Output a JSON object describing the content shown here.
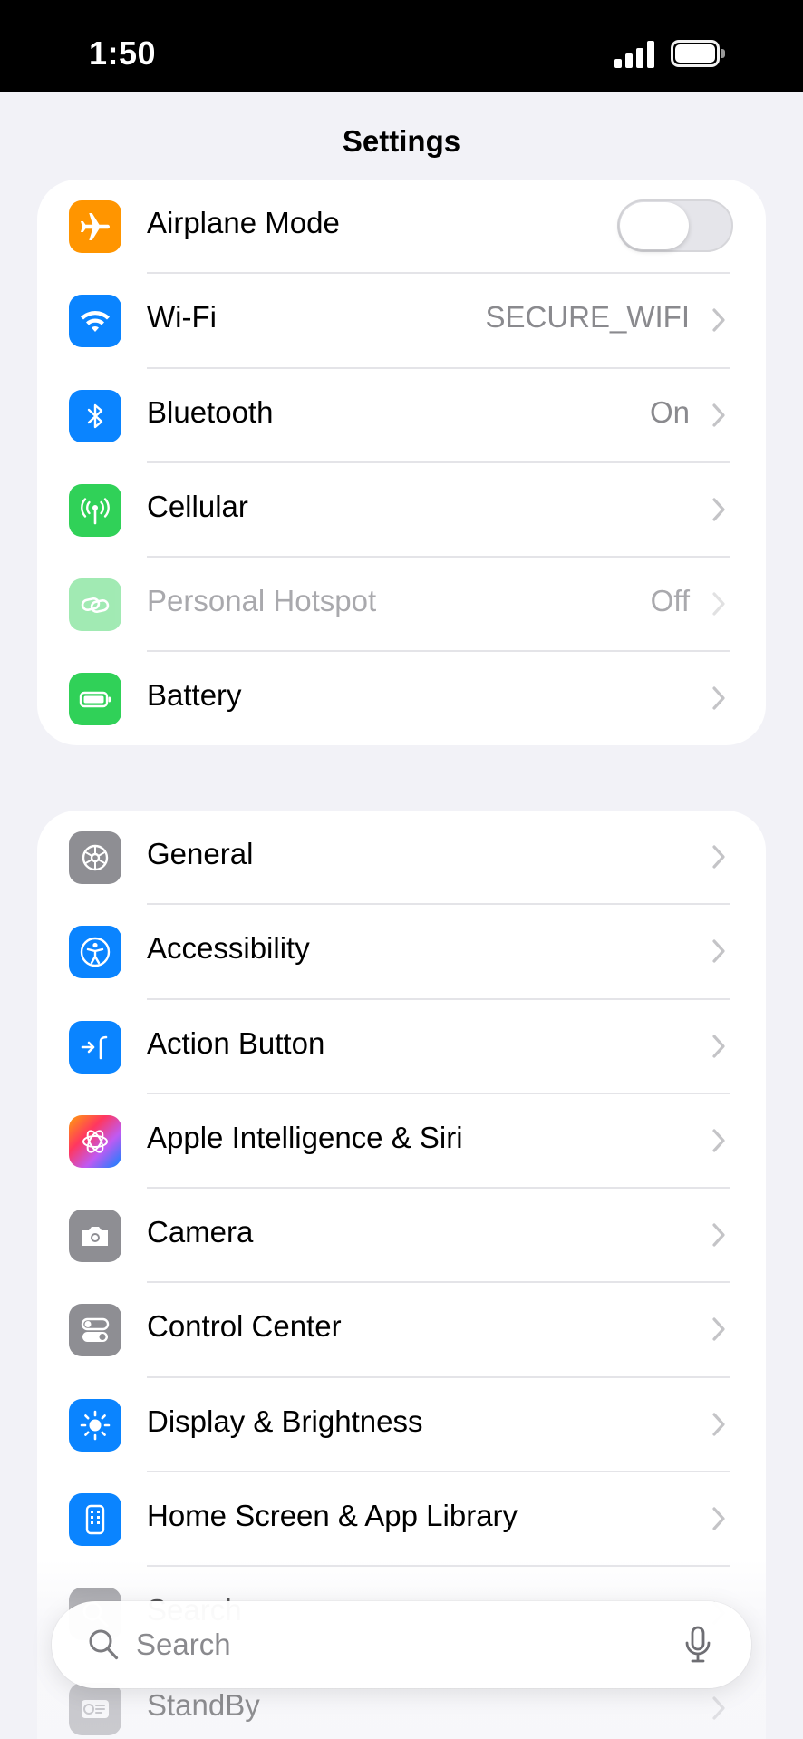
{
  "status_bar": {
    "time": "1:50"
  },
  "nav": {
    "title": "Settings"
  },
  "group1": {
    "items": [
      {
        "label": "Airplane Mode",
        "toggle_on": false,
        "icon": "airplane-icon",
        "color": "#FF9500"
      },
      {
        "label": "Wi-Fi",
        "value": "SECURE_WIFI",
        "icon": "wifi-icon",
        "color": "#0A84FF"
      },
      {
        "label": "Bluetooth",
        "value": "On",
        "icon": "bluetooth-icon",
        "color": "#0A84FF"
      },
      {
        "label": "Cellular",
        "value": "",
        "icon": "antenna-icon",
        "color": "#30D158"
      },
      {
        "label": "Personal Hotspot",
        "value": "Off",
        "icon": "link-icon",
        "color": "#30D158",
        "disabled": true
      },
      {
        "label": "Battery",
        "value": "",
        "icon": "battery-icon",
        "color": "#30D158"
      }
    ]
  },
  "group2": {
    "items": [
      {
        "label": "General",
        "icon": "gear-icon",
        "color": "#8E8E93"
      },
      {
        "label": "Accessibility",
        "icon": "accessibility-icon",
        "color": "#0A84FF"
      },
      {
        "label": "Action Button",
        "icon": "action-button-icon",
        "color": "#0A84FF"
      },
      {
        "label": "Apple Intelligence & Siri",
        "icon": "apple-intelligence-icon",
        "color": "#FF6B6B"
      },
      {
        "label": "Camera",
        "icon": "camera-icon",
        "color": "#8E8E93"
      },
      {
        "label": "Control Center",
        "icon": "toggles-icon",
        "color": "#8E8E93"
      },
      {
        "label": "Display & Brightness",
        "icon": "sun-icon",
        "color": "#0A84FF"
      },
      {
        "label": "Home Screen & App Library",
        "icon": "phone-grid-icon",
        "color": "#0A84FF"
      },
      {
        "label": "Search",
        "icon": "search-icon",
        "color": "#8E8E93"
      },
      {
        "label": "StandBy",
        "icon": "standby-icon",
        "color": "#8E8E93"
      }
    ]
  },
  "search": {
    "placeholder": "Search"
  }
}
